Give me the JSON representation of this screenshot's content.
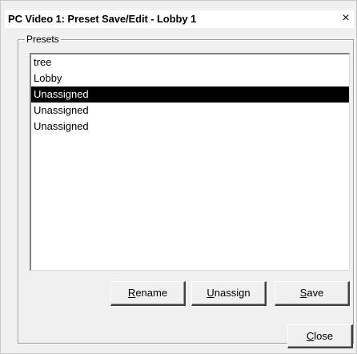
{
  "window": {
    "title": "PC Video 1: Preset Save/Edit - Lobby 1",
    "close_glyph": "×"
  },
  "presets": {
    "label": "Presets",
    "items": [
      {
        "label": "tree",
        "selected": false
      },
      {
        "label": "Lobby",
        "selected": false
      },
      {
        "label": "Unassigned",
        "selected": true
      },
      {
        "label": "Unassigned",
        "selected": false
      },
      {
        "label": "Unassigned",
        "selected": false
      }
    ]
  },
  "buttons": {
    "rename": {
      "accel": "R",
      "rest": "ename"
    },
    "unassign": {
      "accel": "U",
      "rest": "nassign"
    },
    "save": {
      "accel": "S",
      "rest": "ave"
    },
    "close": {
      "accel": "C",
      "rest": "lose"
    }
  }
}
